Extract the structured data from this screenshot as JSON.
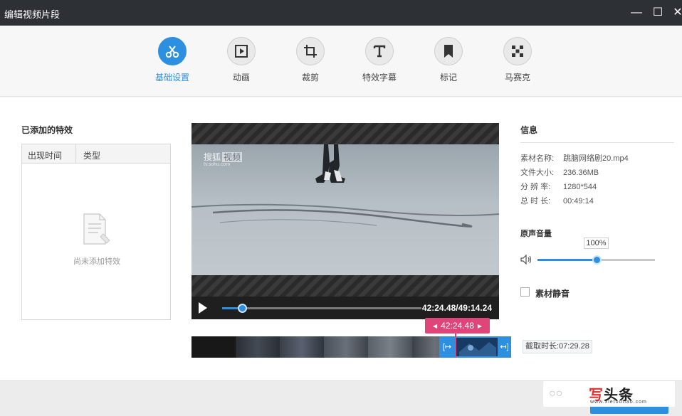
{
  "window": {
    "title": "编辑视频片段",
    "minimize_glyph": "—",
    "maximize_glyph": "☐",
    "close_glyph": "✕"
  },
  "toolbar": {
    "tabs": [
      {
        "label": "基础设置",
        "icon": "scissors-icon",
        "active": true
      },
      {
        "label": "动画",
        "icon": "animation-play-icon",
        "active": false
      },
      {
        "label": "裁剪",
        "icon": "crop-icon",
        "active": false
      },
      {
        "label": "特效字幕",
        "icon": "text-icon",
        "active": false
      },
      {
        "label": "标记",
        "icon": "bookmark-icon",
        "active": false
      },
      {
        "label": "马赛克",
        "icon": "mosaic-icon",
        "active": false
      }
    ]
  },
  "effects": {
    "title": "已添加的特效",
    "columns": [
      "出现时间",
      "类型"
    ],
    "empty_text": "尚未添加特效"
  },
  "player": {
    "watermark": {
      "brand": "搜狐",
      "tag": "视频",
      "site": "tv.sohu.com"
    },
    "time": "42:24.48/49:14.24",
    "progress": 0.1
  },
  "timeline": {
    "current_time": "42:24.48",
    "left_arrow": "◀",
    "right_arrow": "▶",
    "start_handle": "[↦",
    "end_handle": "↤]",
    "duration_text": "截取时长:07:29.28"
  },
  "info": {
    "title": "信息",
    "rows": [
      {
        "key": "素材名称:",
        "value": "跳脑网络剧20.mp4"
      },
      {
        "key": "文件大小:",
        "value": "236.36MB"
      },
      {
        "key": "分 辨 率:",
        "value": "1280*544"
      },
      {
        "key": "总 时 长:",
        "value": "00:49:14"
      }
    ],
    "volume_title": "原声音量",
    "volume_text": "100%",
    "volume_level": 0.5,
    "mute_label": "素材静音"
  },
  "footer": {
    "logo_bubble": "○○",
    "logo_main_accent": "写",
    "logo_main_rest": "头条",
    "logo_sub": "www.xietoutiao.com"
  },
  "colors": {
    "accent": "#2d8fe0",
    "marker": "#e0457a",
    "titlebar": "#2d3035"
  }
}
